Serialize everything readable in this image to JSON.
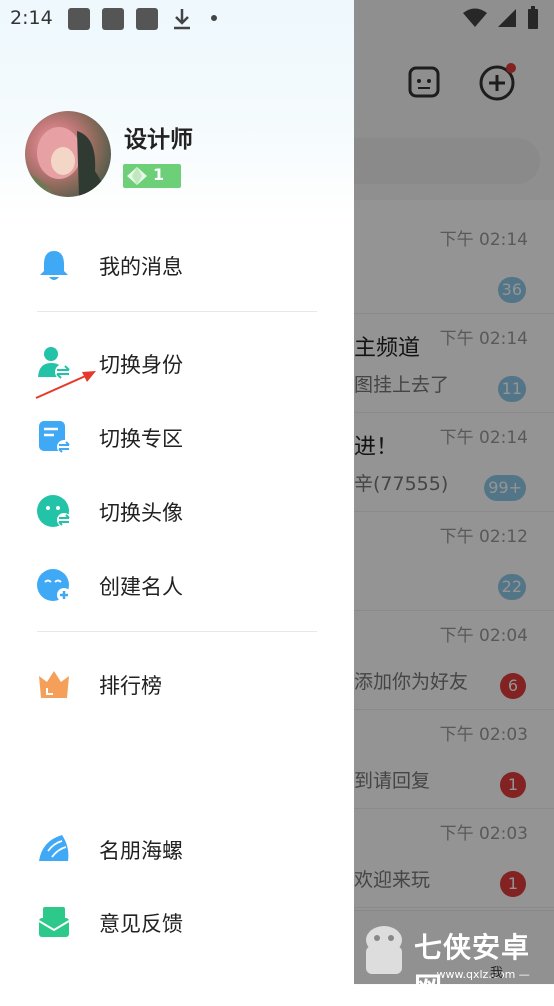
{
  "status_bar": {
    "time": "2:14"
  },
  "background_app": {
    "conversations": [
      {
        "time": "下午 02:14",
        "title": "",
        "snippet": "",
        "badge": "36",
        "badge_color": "#8ecbe8"
      },
      {
        "time": "下午 02:14",
        "title": "主频道",
        "snippet": "图挂上去了",
        "badge": "11",
        "badge_color": "#8ecbe8"
      },
      {
        "time": "下午 02:14",
        "title": "进！",
        "snippet": "辛(77555)",
        "badge": "99+",
        "badge_color": "#8ecbe8"
      },
      {
        "time": "下午 02:12",
        "title": "",
        "snippet": "",
        "badge": "22",
        "badge_color": "#8ecbe8"
      },
      {
        "time": "下午 02:04",
        "title": "",
        "snippet": "添加你为好友",
        "badge": "6",
        "badge_color": "#e23b3b"
      },
      {
        "time": "下午 02:03",
        "title": "",
        "snippet": "到请回复",
        "badge": "1",
        "badge_color": "#e23b3b"
      },
      {
        "time": "下午 02:03",
        "title": "",
        "snippet": "欢迎来玩",
        "badge": "1",
        "badge_color": "#e23b3b"
      }
    ],
    "tab_me_label": "我"
  },
  "watermark": {
    "text": "七侠安卓网",
    "url": "— www.qxlz.com —"
  },
  "drawer": {
    "profile": {
      "name": "设计师",
      "level": "1"
    },
    "menu": [
      {
        "label": "我的消息",
        "icon": "bell-icon",
        "color": "#3fa9f5"
      },
      {
        "label": "切换身份",
        "icon": "switch-identity-icon",
        "color": "#22c3a6"
      },
      {
        "label": "切换专区",
        "icon": "switch-zone-icon",
        "color": "#3fa9f5"
      },
      {
        "label": "切换头像",
        "icon": "switch-avatar-icon",
        "color": "#22c3a6"
      },
      {
        "label": "创建名人",
        "icon": "create-celebrity-icon",
        "color": "#3fa9f5"
      },
      {
        "label": "排行榜",
        "icon": "crown-icon",
        "color": "#f5a05a"
      },
      {
        "label": "名朋海螺",
        "icon": "conch-icon",
        "color": "#3fa9f5"
      },
      {
        "label": "意见反馈",
        "icon": "feedback-icon",
        "color": "#2dc98a"
      }
    ]
  }
}
